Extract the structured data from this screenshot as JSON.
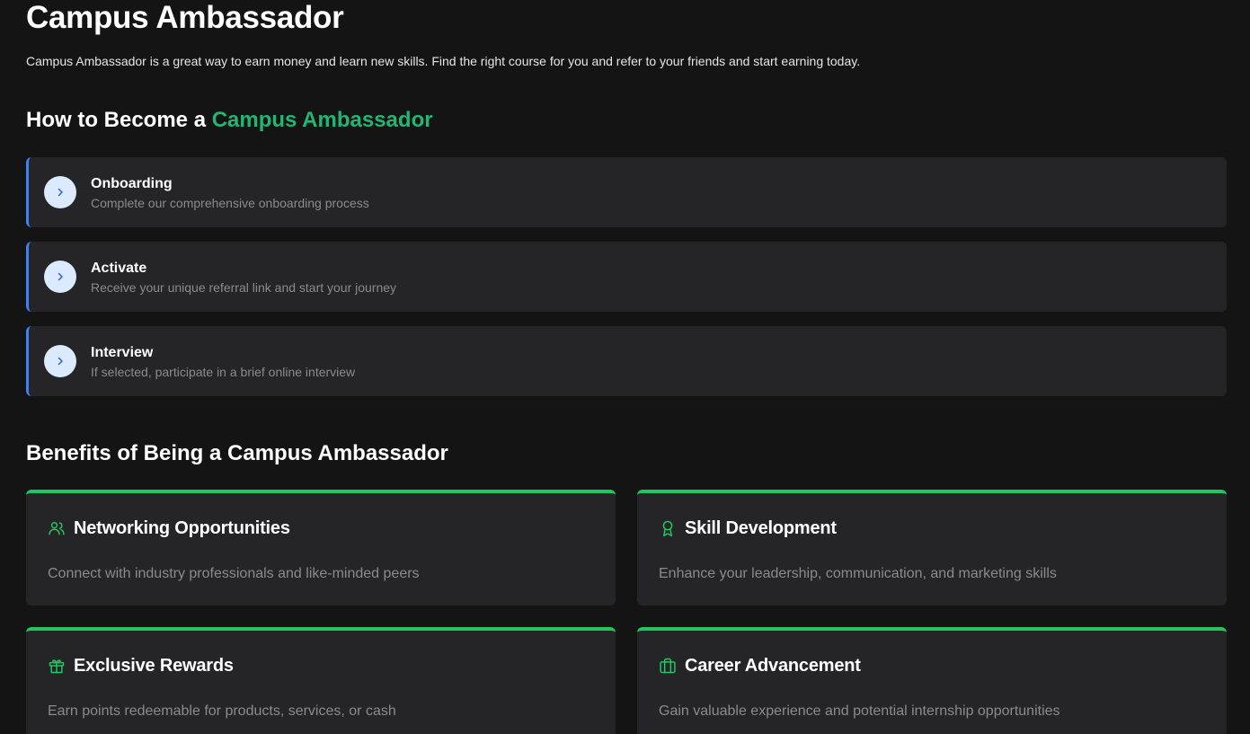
{
  "header": {
    "title": "Campus Ambassador",
    "intro": "Campus Ambassador is a great way to earn money and learn new skills. Find the right course for you and refer to your friends and start earning today."
  },
  "how_to": {
    "title_prefix": "How to Become a ",
    "title_accent": "Campus Ambassador",
    "steps": [
      {
        "title": "Onboarding",
        "description": "Complete our comprehensive onboarding process",
        "icon": "chevron-right-icon"
      },
      {
        "title": "Activate",
        "description": "Receive your unique referral link and start your journey",
        "icon": "chevron-right-icon"
      },
      {
        "title": "Interview",
        "description": "If selected, participate in a brief online interview",
        "icon": "chevron-right-icon"
      }
    ]
  },
  "benefits": {
    "title": "Benefits of Being a Campus Ambassador",
    "items": [
      {
        "title": "Networking Opportunities",
        "description": "Connect with industry professionals and like-minded peers",
        "icon": "users-icon"
      },
      {
        "title": "Skill Development",
        "description": "Enhance your leadership, communication, and marketing skills",
        "icon": "award-icon"
      },
      {
        "title": "Exclusive Rewards",
        "description": "Earn points redeemable for products, services, or cash",
        "icon": "gift-icon"
      },
      {
        "title": "Career Advancement",
        "description": "Gain valuable experience and potential internship opportunities",
        "icon": "briefcase-icon"
      }
    ]
  },
  "colors": {
    "background": "#141414",
    "card": "#252528",
    "accent_green": "#22b573",
    "step_border": "#3b82f6",
    "benefit_border": "#22c55e",
    "muted_text": "#8a8a8f"
  }
}
